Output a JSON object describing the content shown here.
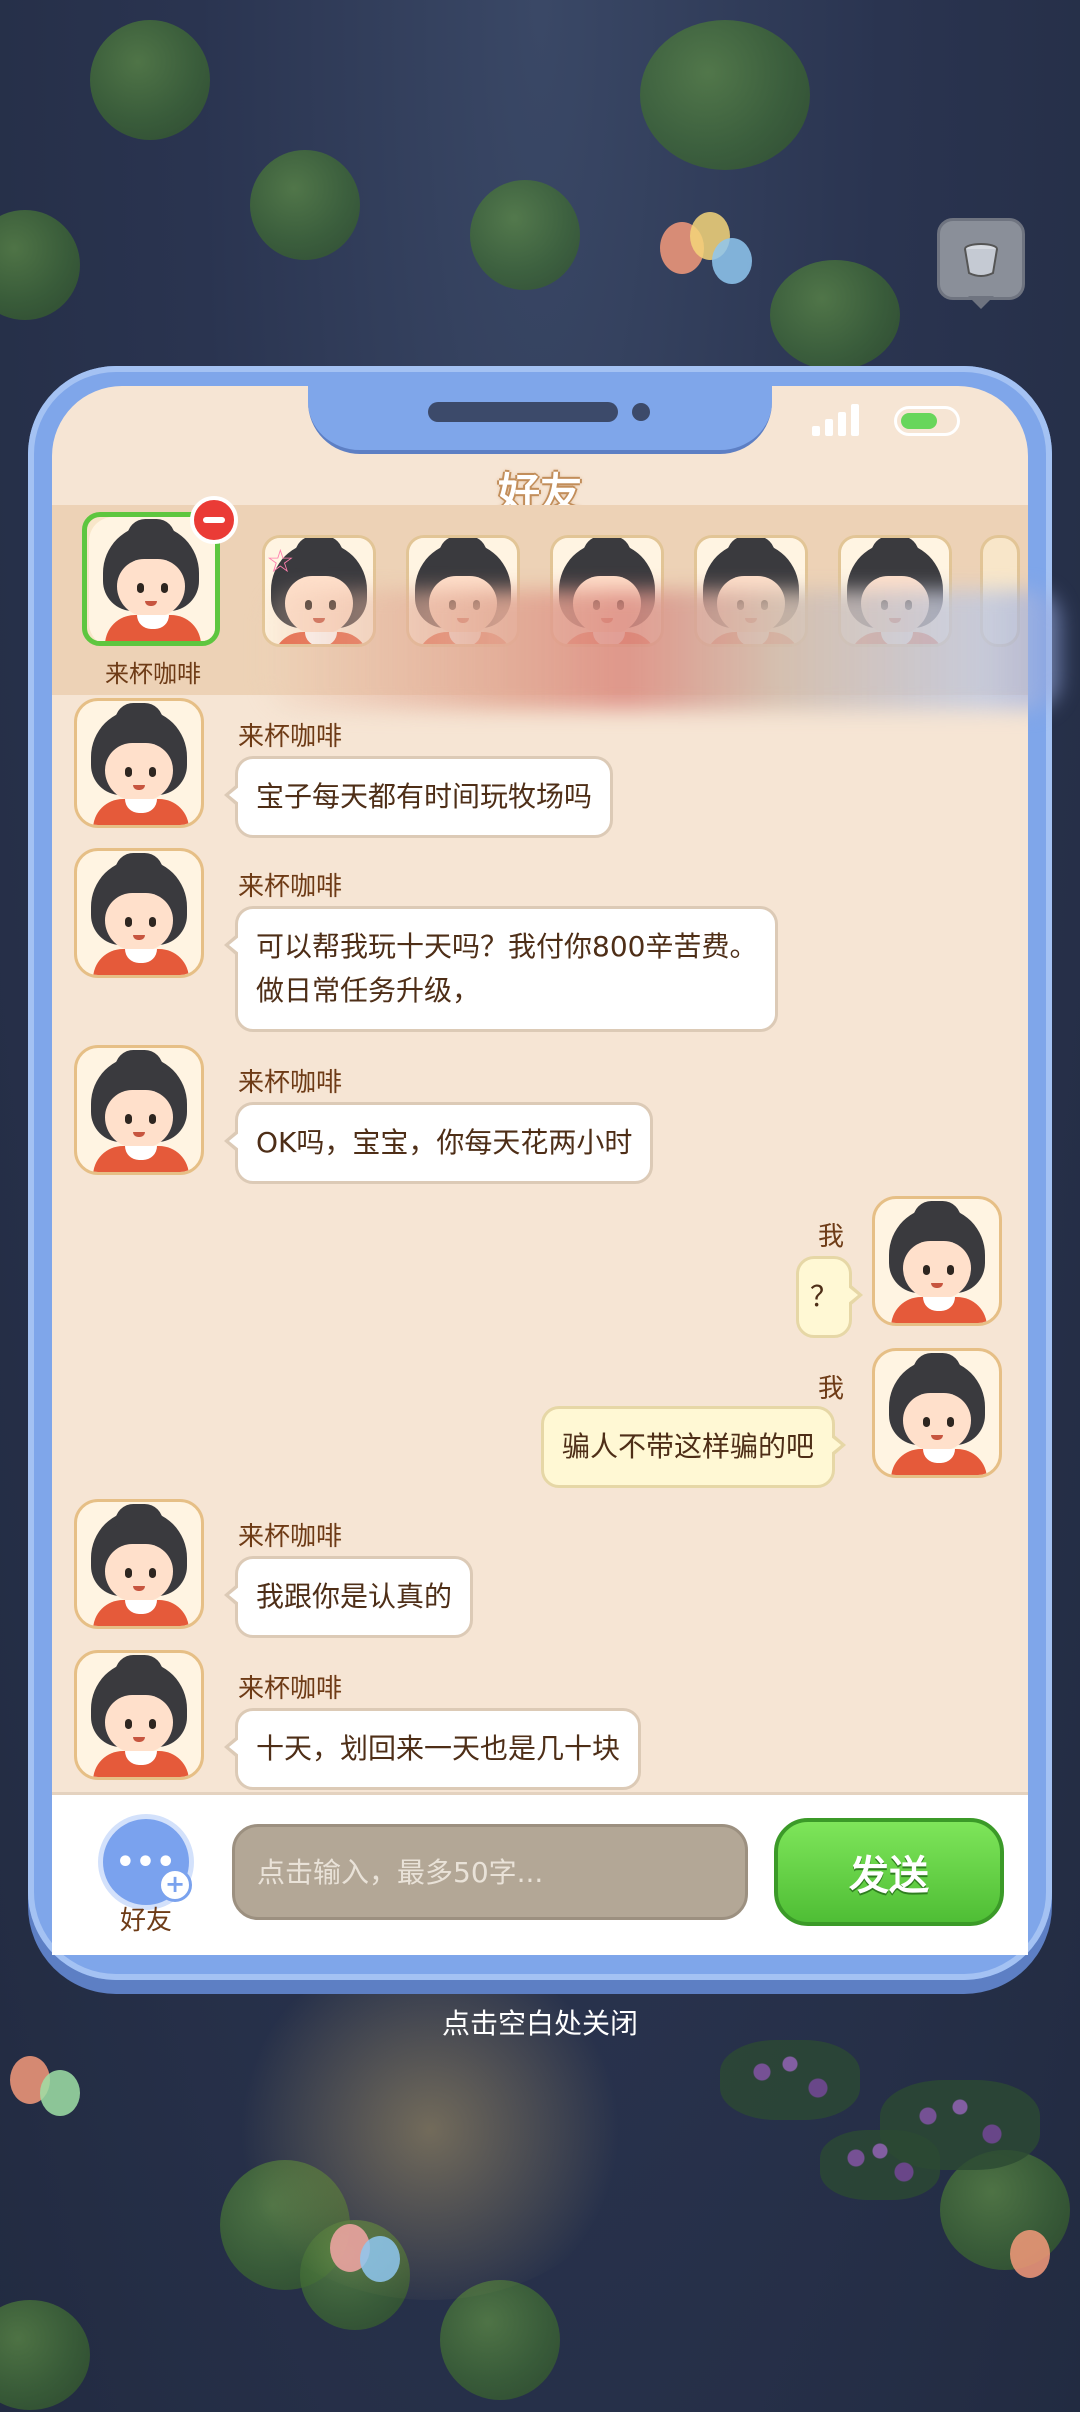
{
  "panel": {
    "title": "好友",
    "close_hint": "点击空白处关闭"
  },
  "friend_list": {
    "selected_friend_name": "来杯咖啡",
    "card_count_visible": 7
  },
  "chat": {
    "messages": [
      {
        "from": "friend",
        "sender": "来杯咖啡",
        "lines": [
          "宝子每天都有时间玩牧场吗"
        ]
      },
      {
        "from": "friend",
        "sender": "来杯咖啡",
        "lines": [
          "可以帮我玩十天吗？我付你800辛苦费。",
          "做日常任务升级，"
        ]
      },
      {
        "from": "friend",
        "sender": "来杯咖啡",
        "lines": [
          "OK吗，宝宝，你每天花两小时"
        ]
      },
      {
        "from": "me",
        "sender": "我",
        "lines": [
          "？"
        ]
      },
      {
        "from": "me",
        "sender": "我",
        "lines": [
          "骗人不带这样骗的吧"
        ]
      },
      {
        "from": "friend",
        "sender": "来杯咖啡",
        "lines": [
          "我跟你是认真的"
        ]
      },
      {
        "from": "friend",
        "sender": "来杯咖啡",
        "lines": [
          "十天，划回来一天也是几十块"
        ]
      }
    ]
  },
  "input_bar": {
    "friends_label": "好友",
    "placeholder": "点击输入，最多50字...",
    "send_label": "发送"
  },
  "colors": {
    "phone_frame": "#7fa6ea",
    "screen_bg": "#f6e5d4",
    "send_green": "#5ec63f",
    "selected_border": "#5ec63f",
    "remove_red": "#ea3b36"
  }
}
